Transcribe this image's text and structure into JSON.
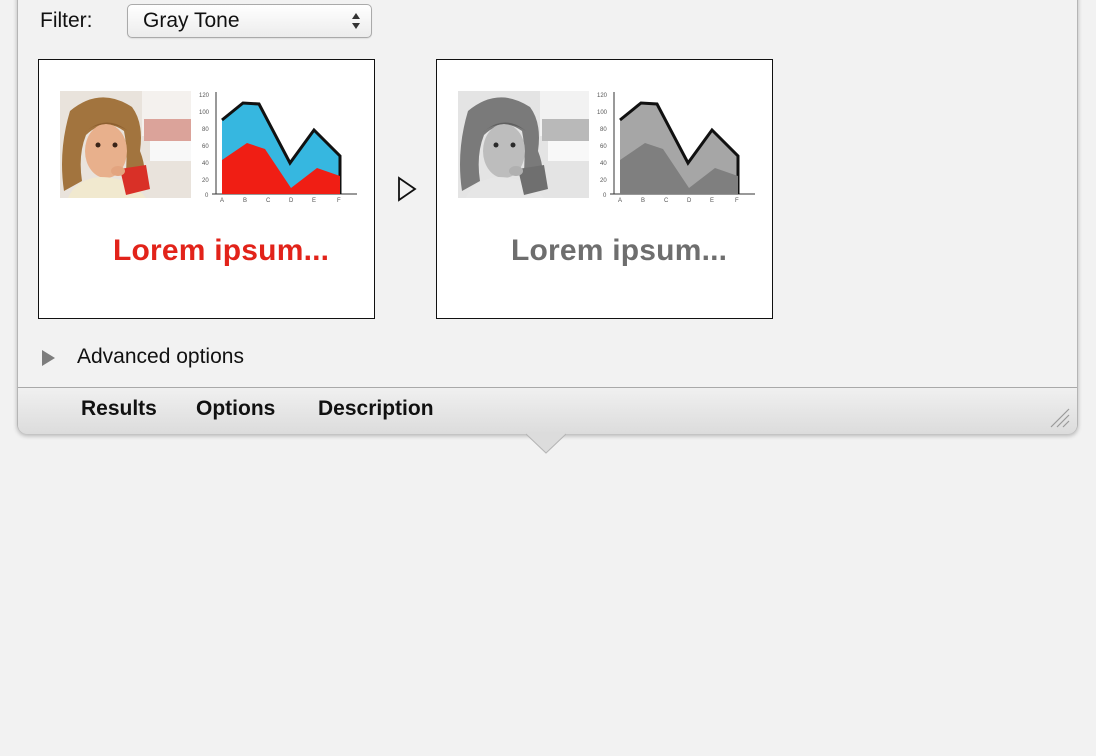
{
  "filter": {
    "label": "Filter:",
    "value": "Gray Tone"
  },
  "preview": {
    "original_text": "Lorem ipsum...",
    "filtered_text": "Lorem ipsum...",
    "original_text_color": "#e2231a",
    "filtered_text_color": "#6e6e6e"
  },
  "chart_thumbnail": {
    "y_ticks": [
      "120",
      "100",
      "80",
      "60",
      "40",
      "20",
      "0"
    ],
    "x_ticks": [
      "A",
      "B",
      "C",
      "D",
      "E",
      "F"
    ],
    "back_series_color": "#36b7e0",
    "front_series_color": "#f01e14"
  },
  "advanced": {
    "label": "Advanced options"
  },
  "tabs": [
    {
      "label": "Results"
    },
    {
      "label": "Options"
    },
    {
      "label": "Description"
    }
  ]
}
